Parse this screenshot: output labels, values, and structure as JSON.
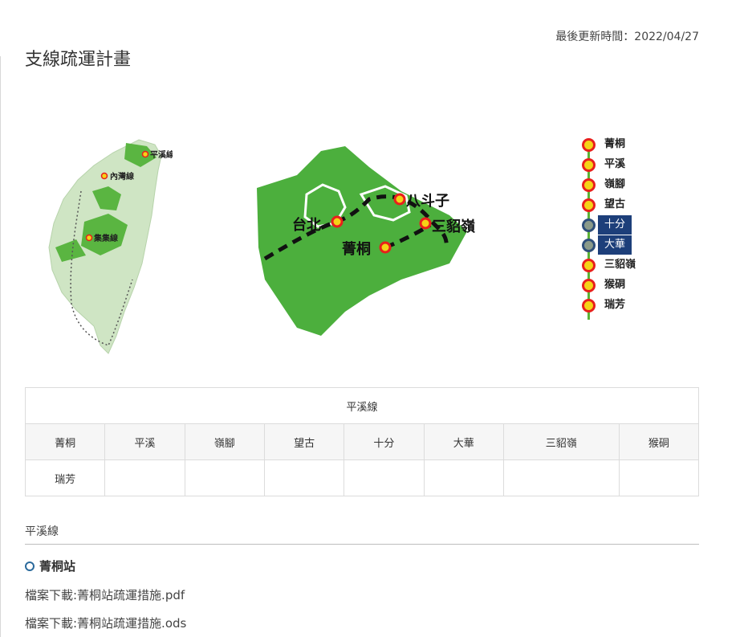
{
  "header": {
    "updated": "最後更新時間：2022/04/27",
    "title": "支線疏運計畫"
  },
  "map": {
    "taiwan_labels": [
      "平溪線",
      "內灣線",
      "集集線"
    ],
    "region_labels": [
      "八斗子",
      "台北",
      "三貂嶺",
      "菁桐"
    ],
    "line_colors": {
      "land": "#4caf3d",
      "route": "#111111",
      "station_fill": "#f5d316",
      "station_ring": "#e8201c"
    }
  },
  "station_list": [
    {
      "name": "菁桐",
      "highlight": false
    },
    {
      "name": "平溪",
      "highlight": false
    },
    {
      "name": "嶺腳",
      "highlight": false
    },
    {
      "name": "望古",
      "highlight": false
    },
    {
      "name": "十分",
      "highlight": true
    },
    {
      "name": "大華",
      "highlight": true
    },
    {
      "name": "三貂嶺",
      "highlight": false
    },
    {
      "name": "猴硐",
      "highlight": false
    },
    {
      "name": "瑞芳",
      "highlight": false
    }
  ],
  "table": {
    "caption": "平溪線",
    "row1": [
      "菁桐",
      "平溪",
      "嶺腳",
      "望古",
      "十分",
      "大華",
      "三貂嶺",
      "猴硐"
    ],
    "row2": [
      "瑞芳",
      "",
      "",
      "",
      "",
      "",
      "",
      ""
    ]
  },
  "section": {
    "line_title": "平溪線",
    "station_title": "菁桐站",
    "downloads": [
      "檔案下載:菁桐站疏運措施.pdf",
      "檔案下載:菁桐站疏運措施.ods"
    ]
  }
}
